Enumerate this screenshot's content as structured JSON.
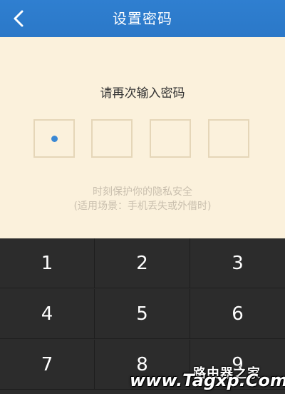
{
  "header": {
    "title": "设置密码",
    "back_icon": "chevron-left-icon",
    "background": "#2b78c8"
  },
  "content": {
    "prompt": "请再次输入密码",
    "pin_length": 4,
    "filled_count": 1,
    "hint_line1": "时刻保护你的隐私安全",
    "hint_line2": "(适用场景：手机丢失或外借时)",
    "background": "#fbf1dc",
    "dot_color": "#3a88d4"
  },
  "keypad": {
    "keys": [
      "1",
      "2",
      "3",
      "4",
      "5",
      "6",
      "7",
      "8",
      "9"
    ],
    "background": "#2c2c2c"
  },
  "watermark": {
    "brand": "路由器之家",
    "url": "www.Tagxp.Com"
  }
}
